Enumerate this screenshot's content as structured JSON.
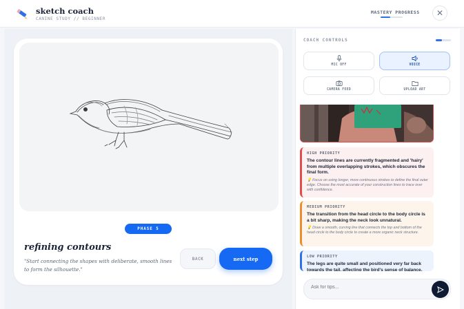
{
  "header": {
    "title": "sketch coach",
    "subtitle": "CANINE STUDY // BEGINNER",
    "mastery_label": "MASTERY PROGRESS",
    "mastery_progress": 0.45,
    "close_icon": "close-icon"
  },
  "lesson": {
    "phase_badge": "PHASE 5",
    "title": "refining contours",
    "quote": "\"Start connecting the shapes with deliberate, smooth lines to form the silhouette.\"",
    "back_label": "BACK",
    "next_label": "next step"
  },
  "coach": {
    "label": "COACH CONTROLS",
    "progress": 0.4,
    "controls": [
      {
        "label": "MIC OFF",
        "icon": "mic-icon",
        "active": false
      },
      {
        "label": "VOICE",
        "icon": "speaker-icon",
        "active": true
      },
      {
        "label": "CAMERA FEED",
        "icon": "camera-icon",
        "active": false
      },
      {
        "label": "UPLOAD ART",
        "icon": "folder-icon",
        "active": false
      }
    ]
  },
  "feedback": [
    {
      "priority": "HIGH PRIORITY",
      "title": "The contour lines are currently fragmented and 'hairy' from multiple overlapping strokes, which obscures the final form.",
      "tip": "💡 Focus on using longer, more continuous strokes to define the final outer edge. Choose the most accurate of your construction lines to trace over with confidence."
    },
    {
      "priority": "MEDIUM PRIORITY",
      "title": "The transition from the head circle to the body circle is a bit sharp, making the neck look unnatural.",
      "tip": "💡 Draw a smooth, curving line that connects the top and bottom of the head circle to the body circle to create a more organic neck structure."
    },
    {
      "priority": "LOW PRIORITY",
      "title": "The legs are quite small and positioned very far back towards the tail, affecting the bird's sense of balance.",
      "tip": ""
    }
  ],
  "ask": {
    "placeholder": "Ask for tips..."
  },
  "colors": {
    "accent": "#1669f2",
    "high": "#e24b4b",
    "medium": "#ee8d2b",
    "low": "#2f6fe8",
    "dark": "#0f1b33"
  }
}
